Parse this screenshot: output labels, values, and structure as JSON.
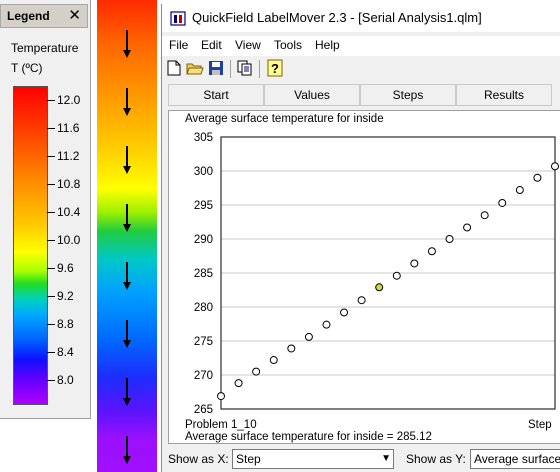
{
  "legend": {
    "title": "Legend",
    "close": "✕",
    "quantity": "Temperature",
    "unit": "T (ºC)",
    "ticks": [
      "12.0",
      "11.6",
      "11.2",
      "10.8",
      "10.4",
      "10.0",
      "9.6",
      "9.2",
      "8.8",
      "8.4",
      "8.0"
    ]
  },
  "window": {
    "title": "QuickField LabelMover 2.3 - [Serial Analysis1.qlm]",
    "menu": [
      "File",
      "Edit",
      "View",
      "Tools",
      "Help"
    ],
    "toolbar_icons": [
      "new-file-icon",
      "open-folder-icon",
      "save-icon",
      "copy-icon",
      "help-icon"
    ],
    "tabs": [
      "Start",
      "Values",
      "Steps",
      "Results"
    ]
  },
  "chart_data": {
    "type": "scatter",
    "title": "Average surface temperature for inside",
    "ylim": [
      265,
      305
    ],
    "yticks": [
      305,
      300,
      295,
      290,
      285,
      280,
      275,
      270,
      265
    ],
    "x": [
      1,
      2,
      3,
      4,
      5,
      6,
      7,
      8,
      9,
      10,
      11,
      12,
      13,
      14,
      15,
      16,
      17,
      18,
      19,
      20
    ],
    "y": [
      266.9,
      268.8,
      270.5,
      272.2,
      273.9,
      275.6,
      277.4,
      279.2,
      281.0,
      282.9,
      284.6,
      286.4,
      288.2,
      290.0,
      291.7,
      293.5,
      295.3,
      297.2,
      299.0,
      300.7
    ],
    "selected_index": 9,
    "point_color": "#ffffff",
    "selected_color": "#d8d830",
    "x_label_left": "Problem 1_10",
    "x_label_right": "Step",
    "readout": "Average surface temperature for inside = 285.12"
  },
  "bottom": {
    "show_x_label": "Show as X:",
    "show_x_value": "Step",
    "show_y_label": "Show as Y:",
    "show_y_value": "Average surface te"
  }
}
